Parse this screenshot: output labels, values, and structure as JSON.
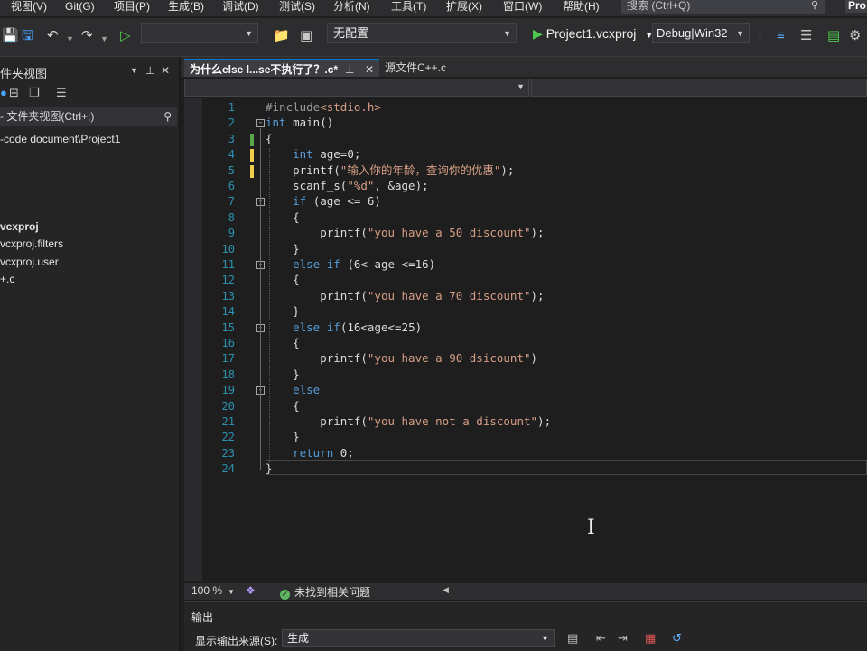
{
  "menu": [
    {
      "id": "view",
      "label": "视图(V)"
    },
    {
      "id": "git",
      "label": "Git(G)"
    },
    {
      "id": "project",
      "label": "项目(P)"
    },
    {
      "id": "build",
      "label": "生成(B)"
    },
    {
      "id": "debug",
      "label": "调试(D)"
    },
    {
      "id": "test",
      "label": "测试(S)"
    },
    {
      "id": "analyze",
      "label": "分析(N)"
    },
    {
      "id": "tools",
      "label": "工具(T)"
    },
    {
      "id": "extensions",
      "label": "扩展(X)"
    },
    {
      "id": "window",
      "label": "窗口(W)"
    },
    {
      "id": "help",
      "label": "帮助(H)"
    }
  ],
  "search": {
    "placeholder": "搜索 (Ctrl+Q)"
  },
  "header": {
    "right_badge": "Pro"
  },
  "toolbar": {
    "config_label": "无配置",
    "run_label": "Project1.vcxproj",
    "build_config": "Debug|Win32"
  },
  "left_panel": {
    "title": "件夹视图",
    "search_placeholder": "- 文件夹视图(Ctrl+;)",
    "tree": [
      {
        "label": "-code document\\Project1",
        "bold": false
      },
      {
        "label": "vcxproj",
        "bold": true
      },
      {
        "label": "vcxproj.filters",
        "bold": false
      },
      {
        "label": "vcxproj.user",
        "bold": false
      },
      {
        "label": "+.c",
        "bold": false
      }
    ]
  },
  "tabs": [
    {
      "label": "为什么else l...se不执行了？.c*",
      "active": true
    },
    {
      "label": "源文件C++.c",
      "active": false
    }
  ],
  "editor": {
    "lines": [
      {
        "n": "1",
        "text": "#include<stdio.h>"
      },
      {
        "n": "2",
        "text": "int main()"
      },
      {
        "n": "3",
        "text": "{"
      },
      {
        "n": "4",
        "text": "    int age=0;"
      },
      {
        "n": "5",
        "text": "    printf(\"输入你的年龄，查询你的优惠\");"
      },
      {
        "n": "6",
        "text": "    scanf_s(\"%d\", &age);"
      },
      {
        "n": "7",
        "text": "    if (age <= 6)"
      },
      {
        "n": "8",
        "text": "    {"
      },
      {
        "n": "9",
        "text": "        printf(\"you have a 50 discount\");"
      },
      {
        "n": "10",
        "text": "    }"
      },
      {
        "n": "11",
        "text": "    else if (6< age <=16)"
      },
      {
        "n": "12",
        "text": "    {"
      },
      {
        "n": "13",
        "text": "        printf(\"you have a 70 discount\");"
      },
      {
        "n": "14",
        "text": "    }"
      },
      {
        "n": "15",
        "text": "    else if(16<age<=25)"
      },
      {
        "n": "16",
        "text": "    {"
      },
      {
        "n": "17",
        "text": "        printf(\"you have a 90 dsicount\")"
      },
      {
        "n": "18",
        "text": "    }"
      },
      {
        "n": "19",
        "text": "    else"
      },
      {
        "n": "20",
        "text": "    {"
      },
      {
        "n": "21",
        "text": "        printf(\"you have not a discount\");"
      },
      {
        "n": "22",
        "text": "    }"
      },
      {
        "n": "23",
        "text": "    return 0;"
      },
      {
        "n": "24",
        "text": "}"
      }
    ]
  },
  "status": {
    "zoom": "100 %",
    "issues": "未找到相关问题"
  },
  "output": {
    "title": "输出",
    "source_label": "显示输出来源(S):",
    "source_value": "生成"
  },
  "colors": {
    "accent": "#007acc",
    "keyword": "#569cd6",
    "string": "#d69d85",
    "line_number": "#2b91af",
    "changed_saved": "#57a64a",
    "changed_unsaved": "#efce4a"
  }
}
